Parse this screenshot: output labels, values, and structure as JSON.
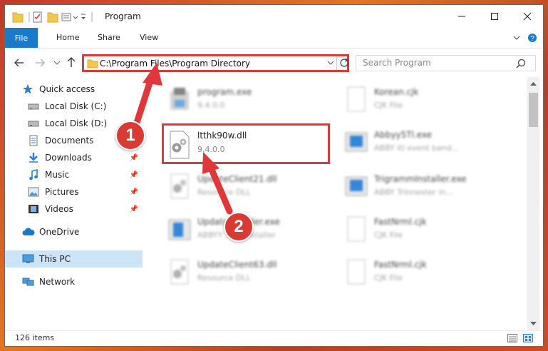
{
  "window": {
    "title": "Program"
  },
  "ribbon": {
    "tabs": [
      "File",
      "Home",
      "Share",
      "View"
    ]
  },
  "address": {
    "path": "C:\\Program Files\\Program Directory"
  },
  "search": {
    "placeholder": "Search Program"
  },
  "sidebar": {
    "items": [
      {
        "label": "Quick access",
        "icon": "star-icon"
      },
      {
        "label": "Local Disk (C:)",
        "icon": "drive-icon"
      },
      {
        "label": "Local Disk (D:)",
        "icon": "drive-icon"
      },
      {
        "label": "Documents",
        "icon": "documents-icon"
      },
      {
        "label": "Downloads",
        "icon": "download-icon"
      },
      {
        "label": "Music",
        "icon": "music-icon"
      },
      {
        "label": "Pictures",
        "icon": "pictures-icon"
      },
      {
        "label": "Videos",
        "icon": "videos-icon"
      },
      {
        "label": "OneDrive",
        "icon": "cloud-icon"
      },
      {
        "label": "This PC",
        "icon": "computer-icon"
      },
      {
        "label": "Network",
        "icon": "network-icon"
      }
    ]
  },
  "files": [
    {
      "name": "program.exe",
      "sub": "9.4.0.0"
    },
    {
      "name": "Korean.cjk",
      "sub": "CJK File"
    },
    {
      "name": "ltthk90w.dll",
      "sub": "9.4.0.0"
    },
    {
      "name": "Abbyy5Tl.exe",
      "sub": "ABBY itl event band..."
    },
    {
      "name": "UpdateClient21.dll",
      "sub": "Resource DLL"
    },
    {
      "name": "TrigrammInstaller.exe",
      "sub": "ABBY Trinnester in..."
    },
    {
      "name": "UpdateInstaller.exe",
      "sub": "ABBYY ...es installer"
    },
    {
      "name": "FastNrml.cjk",
      "sub": "CJK File"
    },
    {
      "name": "UpdateClient63.dll",
      "sub": "Resource DLL"
    },
    {
      "name": "FastNrml.cjk",
      "sub": "CJK File"
    }
  ],
  "status": {
    "count": "126 items"
  },
  "annotations": {
    "step1": "1",
    "step2": "2"
  },
  "colors": {
    "accent": "#1979ca",
    "highlight": "#e0383a",
    "selected": "#cce4f7"
  }
}
